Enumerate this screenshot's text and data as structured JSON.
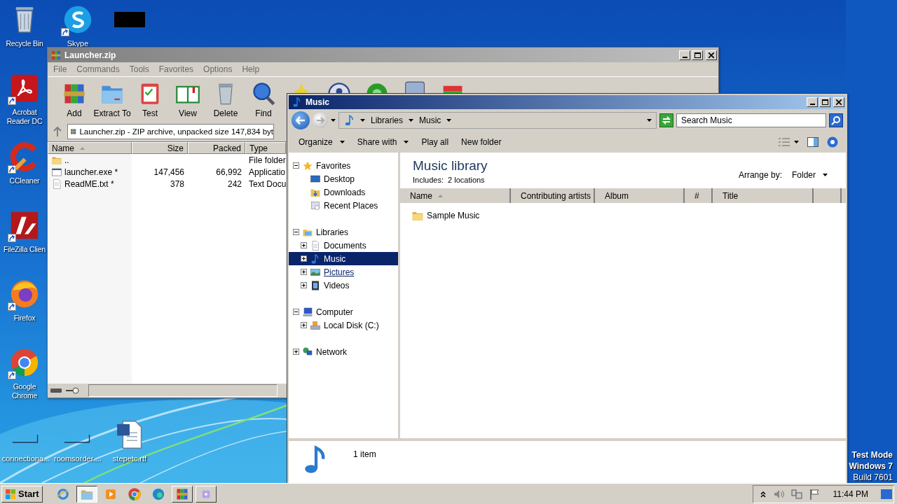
{
  "desktop": {
    "left_column": [
      {
        "label": "Recycle Bin",
        "kind": "bin",
        "shortcut": false
      },
      {
        "label": "Acrobat Reader DC",
        "kind": "acrobat",
        "shortcut": true
      },
      {
        "label": "CCleaner",
        "kind": "ccleaner",
        "shortcut": true
      },
      {
        "label": "FileZilla Clien",
        "kind": "filezilla",
        "shortcut": true
      },
      {
        "label": "Firefox",
        "kind": "firefox",
        "shortcut": true
      },
      {
        "label": "Google Chrome",
        "kind": "chrome",
        "shortcut": true
      }
    ],
    "top_row": [
      {
        "label": "Skype",
        "kind": "skype",
        "shortcut": true
      },
      {
        "kind": "image",
        "shortcut": false
      }
    ],
    "bottom_row": [
      {
        "label": "connectiona...",
        "kind": "blank",
        "shortcut": false
      },
      {
        "label": "roomsorder....",
        "kind": "blank",
        "shortcut": false
      },
      {
        "label": "stepetc.rtf",
        "kind": "word",
        "shortcut": false
      }
    ]
  },
  "archive_window": {
    "title": "Launcher.zip",
    "menu": [
      "File",
      "Commands",
      "Tools",
      "Favorites",
      "Options",
      "Help"
    ],
    "toolbar": [
      {
        "label": "Add",
        "kind": "add"
      },
      {
        "label": "Extract To",
        "kind": "extract"
      },
      {
        "label": "Test",
        "kind": "test"
      },
      {
        "label": "View",
        "kind": "view"
      },
      {
        "label": "Delete",
        "kind": "delete"
      },
      {
        "label": "Find",
        "kind": "find"
      },
      {
        "kind": "wizard"
      },
      {
        "kind": "info"
      },
      {
        "kind": "virus"
      },
      {
        "kind": "comment"
      },
      {
        "kind": "sfx"
      }
    ],
    "path": "Launcher.zip - ZIP archive, unpacked size 147,834 byt",
    "columns": [
      {
        "label": "Name",
        "sorted": true
      },
      {
        "label": "Size",
        "sorted": false
      },
      {
        "label": "Packed",
        "sorted": false
      },
      {
        "label": "Type",
        "sorted": false
      }
    ],
    "rows": [
      {
        "name": "..",
        "kind": "up",
        "type": "File folder"
      },
      {
        "name": "launcher.exe *",
        "kind": "exe",
        "size": "147,456",
        "packed": "66,992",
        "type": "Applicatio"
      },
      {
        "name": "ReadME.txt *",
        "kind": "txt",
        "size": "378",
        "packed": "242",
        "type": "Text Docu"
      }
    ]
  },
  "explorer_window": {
    "title": "Music",
    "breadcrumb": [
      "Libraries",
      "Music"
    ],
    "search": {
      "placeholder": "Search Music"
    },
    "commands": [
      {
        "label": "Organize",
        "dropdown": true
      },
      {
        "label": "Share with",
        "dropdown": true
      },
      {
        "label": "Play all",
        "dropdown": false
      },
      {
        "label": "New folder",
        "dropdown": false
      }
    ],
    "nav": [
      {
        "label": "Favorites",
        "kind": "star",
        "expanded": true,
        "selected": false,
        "hovered": false,
        "children": [
          {
            "label": "Desktop",
            "kind": "desktop",
            "selected": false,
            "hovered": false
          },
          {
            "label": "Downloads",
            "kind": "downloads",
            "selected": false,
            "hovered": false
          },
          {
            "label": "Recent Places",
            "kind": "recent",
            "selected": false,
            "hovered": false
          }
        ]
      },
      {
        "label": "Libraries",
        "kind": "library",
        "expanded": true,
        "selected": false,
        "hovered": false,
        "children": [
          {
            "label": "Documents",
            "kind": "documents",
            "expanded": false,
            "selected": false,
            "hovered": false
          },
          {
            "label": "Music",
            "kind": "music",
            "expanded": false,
            "selected": true,
            "hovered": false
          },
          {
            "label": "Pictures",
            "kind": "pictures",
            "expanded": false,
            "selected": false,
            "hovered": true
          },
          {
            "label": "Videos",
            "kind": "videos",
            "expanded": false,
            "selected": false,
            "hovered": false
          }
        ]
      },
      {
        "label": "Computer",
        "kind": "computer",
        "expanded": true,
        "selected": false,
        "hovered": false,
        "children": [
          {
            "label": "Local Disk (C:)",
            "kind": "disk",
            "expanded": false,
            "selected": false,
            "hovered": false
          }
        ]
      },
      {
        "label": "Network",
        "kind": "network",
        "expanded": false,
        "selected": false,
        "hovered": false
      }
    ],
    "library": {
      "title": "Music library",
      "includes_label": "Includes:",
      "includes_value": "2 locations",
      "arrange_label": "Arrange by:",
      "arrange_value": "Folder"
    },
    "columns": [
      {
        "label": "Name",
        "sorted": true
      },
      {
        "label": "Contributing artists",
        "sorted": false
      },
      {
        "label": "Album",
        "sorted": false
      },
      {
        "label": "#",
        "sorted": false
      },
      {
        "label": "Title",
        "sorted": false
      }
    ],
    "items": [
      {
        "name": "Sample Music",
        "kind": "folder"
      }
    ],
    "details": {
      "count": "1 item"
    }
  },
  "test_mode_notice": [
    "Test Mode",
    "Windows 7",
    "Build 7601"
  ],
  "taskbar": {
    "start": "Start",
    "apps": [
      {
        "kind": "ie",
        "running": false,
        "selected": false
      },
      {
        "kind": "explorer",
        "running": true,
        "selected": true
      },
      {
        "kind": "media",
        "running": false,
        "selected": false
      },
      {
        "kind": "chrome",
        "running": false,
        "selected": false
      },
      {
        "kind": "edge",
        "running": false,
        "selected": false
      },
      {
        "kind": "winrar",
        "running": true,
        "selected": false
      },
      {
        "kind": "flower",
        "running": true,
        "selected": false
      }
    ],
    "time": "11:44 PM"
  }
}
